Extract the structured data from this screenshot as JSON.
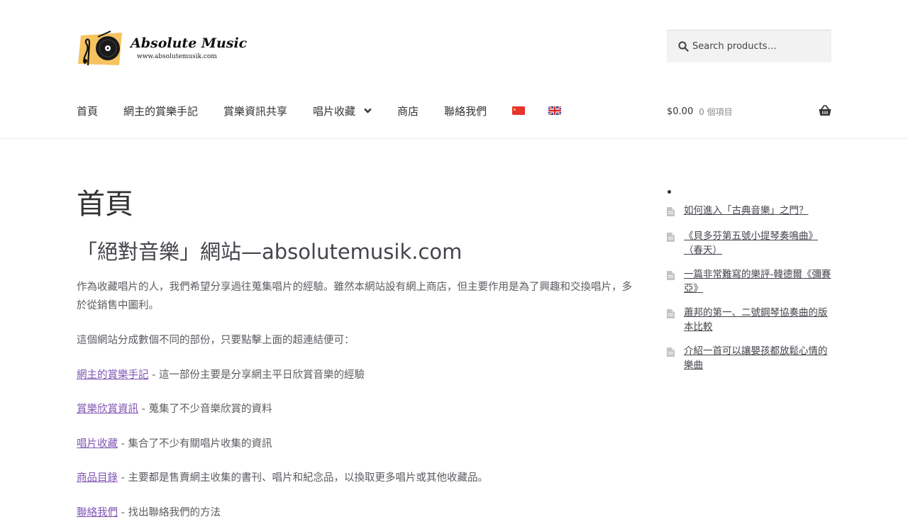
{
  "site": {
    "logo_title": "Absolute Music",
    "logo_url": "www.absolutemusik.com"
  },
  "search": {
    "placeholder": "Search products…"
  },
  "nav": {
    "items": [
      {
        "label": "首頁"
      },
      {
        "label": "網主的賞樂手記"
      },
      {
        "label": "賞樂資訊共享"
      },
      {
        "label": "唱片收藏"
      },
      {
        "label": "商店"
      },
      {
        "label": "聯絡我們"
      }
    ],
    "flags": [
      "china-flag-icon",
      "uk-flag-icon"
    ]
  },
  "cart": {
    "amount": "$0.00",
    "count": "0 個項目"
  },
  "main": {
    "title": "首頁",
    "subtitle": "「絕對音樂」網站—absolutemusik.com",
    "intro": "作為收藏唱片的人，我們希望分享過往蒐集唱片的經驗。雖然本網站設有網上商店，但主要作用是為了興趣和交換唱片，多於從銷售中圖利。",
    "sections_intro": "這個網站分成數個不同的部份，只要點擊上面的超連結便可：",
    "links": [
      {
        "label": "網主的賞樂手記",
        "desc": " - 這一部份主要是分享網主平日欣賞音樂的經驗"
      },
      {
        "label": "賞樂欣賞資訊",
        "desc": " - 蒐集了不少音樂欣賞的資料"
      },
      {
        "label": "唱片收藏",
        "desc": " - 集合了不少有關唱片收集的資訊"
      },
      {
        "label": "商品目錄",
        "desc": " - 主要都是售賣網主收集的書刊、唱片和紀念品，以換取更多唱片或其他收藏品。"
      },
      {
        "label": "聯絡我們",
        "desc": " - 找出聯絡我們的方法"
      }
    ]
  },
  "sidebar": {
    "posts": [
      {
        "title": "如何進入「古典音樂」之門？"
      },
      {
        "title": "《貝多芬第五號小提琴奏鳴曲》（春天）"
      },
      {
        "title": "一篇非常難寫的樂評-韓德爾《彌賽亞》"
      },
      {
        "title": "蕭邦的第一、二號鋼琴協奏曲的版本比較"
      },
      {
        "title": "介紹一首可以讓嬰孩都放鬆心情的樂曲"
      }
    ]
  },
  "colors": {
    "link": "#7f54b3",
    "text": "#43454b",
    "search_bg": "#f2f2f2",
    "logo_accent": "#f4b944"
  }
}
